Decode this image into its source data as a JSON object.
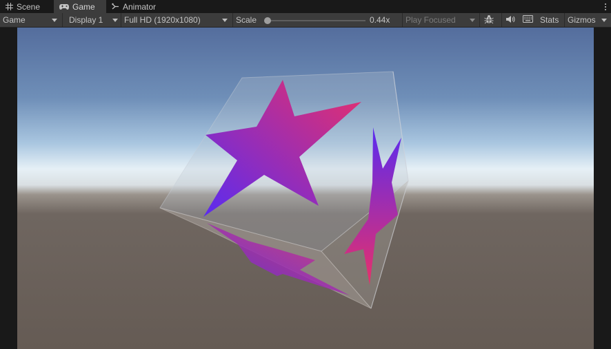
{
  "tabs": [
    {
      "label": "Scene",
      "icon": "grid-icon",
      "active": false
    },
    {
      "label": "Game",
      "icon": "gamepad-icon",
      "active": true
    },
    {
      "label": "Animator",
      "icon": "animator-icon",
      "active": false
    }
  ],
  "toolbar": {
    "view_mode": "Game",
    "display": "Display 1",
    "resolution": "Full HD (1920x1080)",
    "scale_label": "Scale",
    "scale_value": "0.44x",
    "scale_fraction": 0.03,
    "play_mode": "Play Focused",
    "stats_label": "Stats",
    "gizmos_label": "Gizmos"
  },
  "colors": {
    "star_gradient_start": "#5a2bf0",
    "star_gradient_end": "#e8306a",
    "sky_top": "#5670a0",
    "horizon": "#e6f0f6",
    "ground": "#675e57"
  }
}
